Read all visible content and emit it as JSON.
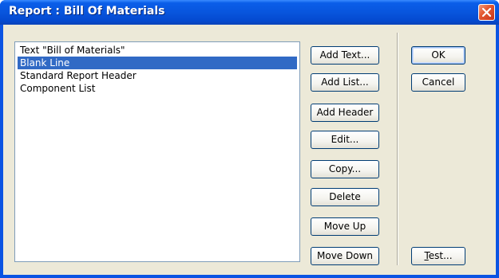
{
  "window": {
    "title": "Report : Bill Of Materials"
  },
  "list": {
    "items": [
      {
        "label": "Text \"Bill of Materials\"",
        "selected": false
      },
      {
        "label": "Blank Line",
        "selected": true
      },
      {
        "label": "Standard Report Header",
        "selected": false
      },
      {
        "label": "Component List",
        "selected": false
      }
    ]
  },
  "actions": {
    "add_text": "Add Text...",
    "add_list": "Add List...",
    "add_header": "Add Header",
    "edit": "Edit...",
    "copy": "Copy...",
    "delete": "Delete",
    "move_up": "Move Up",
    "move_down": "Move Down"
  },
  "dialog": {
    "ok": "OK",
    "cancel": "Cancel",
    "test_mnemonic": "T",
    "test_rest": "est..."
  },
  "colors": {
    "titlebar": "#0855dd",
    "selection": "#316ac5",
    "dialog_bg": "#ece9d8",
    "close_button": "#e45a32"
  },
  "icons": {
    "close": "close-icon"
  }
}
